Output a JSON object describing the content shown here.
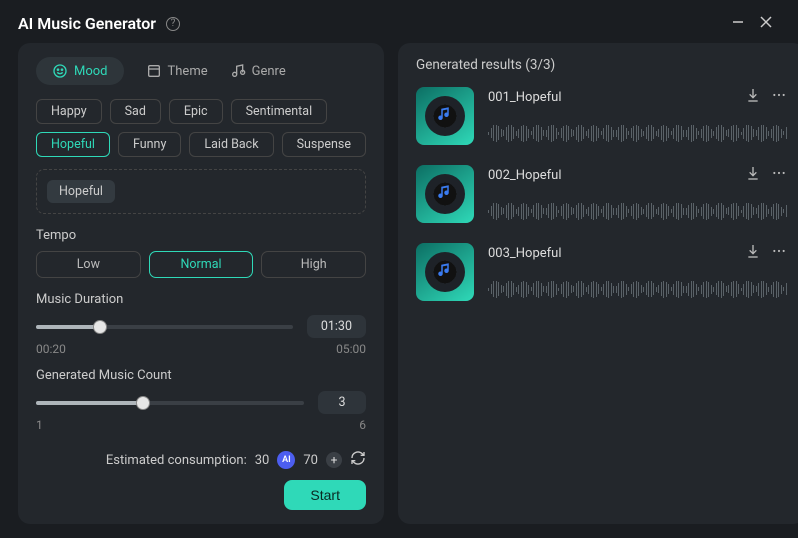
{
  "app": {
    "title": "AI Music Generator"
  },
  "tabs": [
    {
      "label": "Mood",
      "active": true
    },
    {
      "label": "Theme",
      "active": false
    },
    {
      "label": "Genre",
      "active": false
    }
  ],
  "mood_chips": [
    {
      "label": "Happy",
      "selected": false
    },
    {
      "label": "Sad",
      "selected": false
    },
    {
      "label": "Epic",
      "selected": false
    },
    {
      "label": "Sentimental",
      "selected": false
    },
    {
      "label": "Hopeful",
      "selected": true
    },
    {
      "label": "Funny",
      "selected": false
    },
    {
      "label": "Laid Back",
      "selected": false
    },
    {
      "label": "Suspense",
      "selected": false
    }
  ],
  "selected_chip": "Hopeful",
  "tempo": {
    "label": "Tempo",
    "options": [
      {
        "label": "Low",
        "active": false
      },
      {
        "label": "Normal",
        "active": true
      },
      {
        "label": "High",
        "active": false
      }
    ]
  },
  "duration": {
    "label": "Music Duration",
    "min_label": "00:20",
    "max_label": "05:00",
    "value_label": "01:30",
    "fill_percent": 25
  },
  "count": {
    "label": "Generated Music Count",
    "min_label": "1",
    "max_label": "6",
    "value_label": "3",
    "fill_percent": 40
  },
  "consumption": {
    "prefix": "Estimated consumption:",
    "value": "30",
    "credits": "70"
  },
  "start_label": "Start",
  "results": {
    "title": "Generated results (3/3)",
    "items": [
      {
        "name": "001_Hopeful"
      },
      {
        "name": "002_Hopeful"
      },
      {
        "name": "003_Hopeful"
      }
    ]
  }
}
